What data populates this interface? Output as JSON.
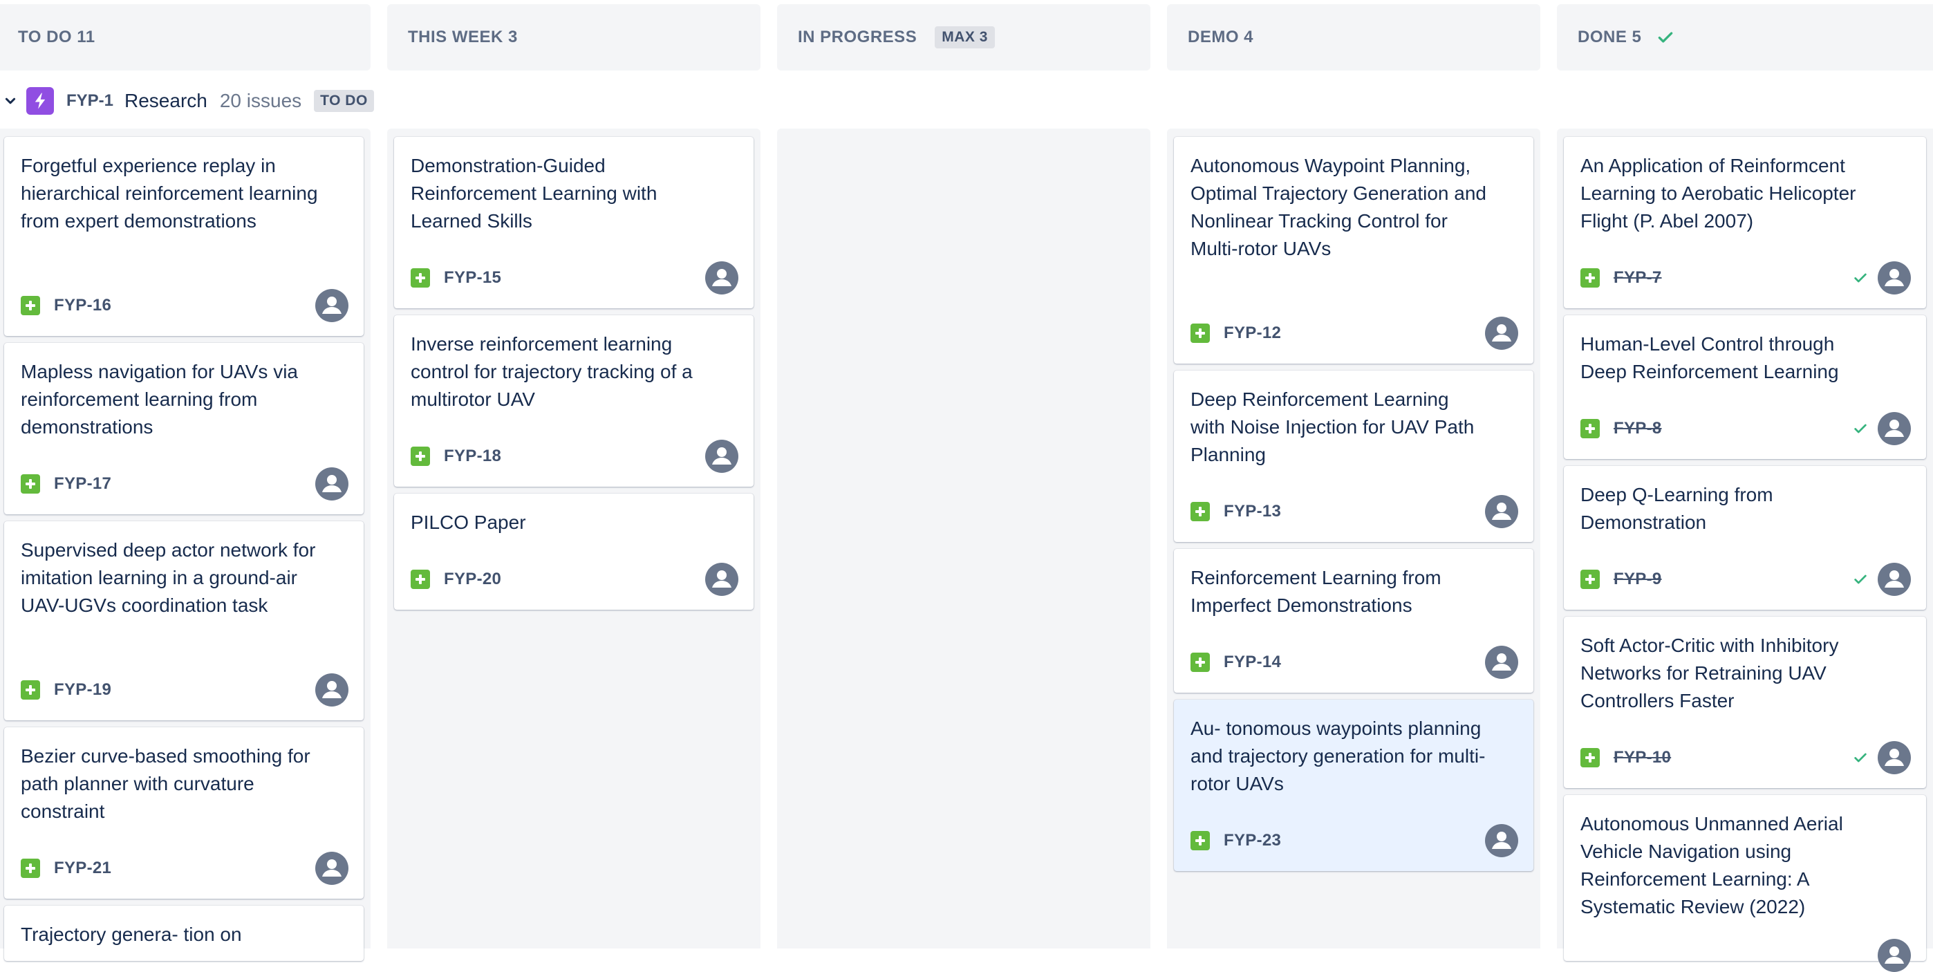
{
  "columns": [
    {
      "title": "TO DO 11"
    },
    {
      "title": "THIS WEEK 3"
    },
    {
      "title": "IN PROGRESS",
      "limit": "MAX 3"
    },
    {
      "title": "DEMO 4"
    },
    {
      "title": "DONE 5"
    }
  ],
  "epic": {
    "key": "FYP-1",
    "name": "Research",
    "count": "20 issues",
    "status": "TO DO"
  },
  "cards": {
    "todo": [
      {
        "title": "Forgetful experience replay in hierarchical reinforcement learning from expert demonstrations",
        "key": "FYP-16"
      },
      {
        "title": "Mapless navigation for UAVs via reinforcement learning from demonstrations",
        "key": "FYP-17"
      },
      {
        "title": "Supervised deep actor network for imitation learning in a ground-air UAV-UGVs coordination task",
        "key": "FYP-19"
      },
      {
        "title": "Bezier curve-based smoothing for path planner with curvature constraint",
        "key": "FYP-21"
      },
      {
        "title": "Trajectory genera- tion on"
      }
    ],
    "thisweek": [
      {
        "title": "Demonstration-Guided Reinforcement Learning with Learned Skills",
        "key": "FYP-15"
      },
      {
        "title": "Inverse reinforcement learning control for trajectory tracking of a multirotor UAV",
        "key": "FYP-18"
      },
      {
        "title": "PILCO Paper",
        "key": "FYP-20"
      }
    ],
    "demo": [
      {
        "title": "Autonomous Waypoint Planning, Optimal Trajectory Generation and Nonlinear Tracking Control for Multi-rotor UAVs",
        "key": "FYP-12"
      },
      {
        "title": "Deep Reinforcement Learning with Noise Injection for UAV Path Planning",
        "key": "FYP-13"
      },
      {
        "title": "Reinforcement Learning from Imperfect Demonstrations",
        "key": "FYP-14"
      },
      {
        "title": "Au- tonomous waypoints planning and trajectory generation for multi-rotor UAVs",
        "key": "FYP-23"
      }
    ],
    "done": [
      {
        "title": "An Application of Reinformcent Learning to Aerobatic Helicopter Flight (P. Abel 2007)",
        "key": "FYP-7"
      },
      {
        "title": "Human-Level Control through Deep Reinforcement Learning",
        "key": "FYP-8"
      },
      {
        "title": "Deep Q-Learning from Demonstration",
        "key": "FYP-9"
      },
      {
        "title": "Soft Actor-Critic with Inhibitory Networks for Retraining UAV Controllers Faster",
        "key": "FYP-10"
      },
      {
        "title": "Autonomous Unmanned Aerial Vehicle Navigation using Reinforcement Learning: A Systematic Review (2022)"
      }
    ]
  },
  "colors": {
    "epic": "#904ee2",
    "story": "#63ba3c",
    "done_check": "#36b37e",
    "selected_card": "#e9f2ff"
  },
  "icons": {
    "epic": "lightning-icon",
    "story": "story-plus-icon",
    "avatar": "avatar-icon",
    "check": "check-icon",
    "chevron": "chevron-down-icon"
  }
}
